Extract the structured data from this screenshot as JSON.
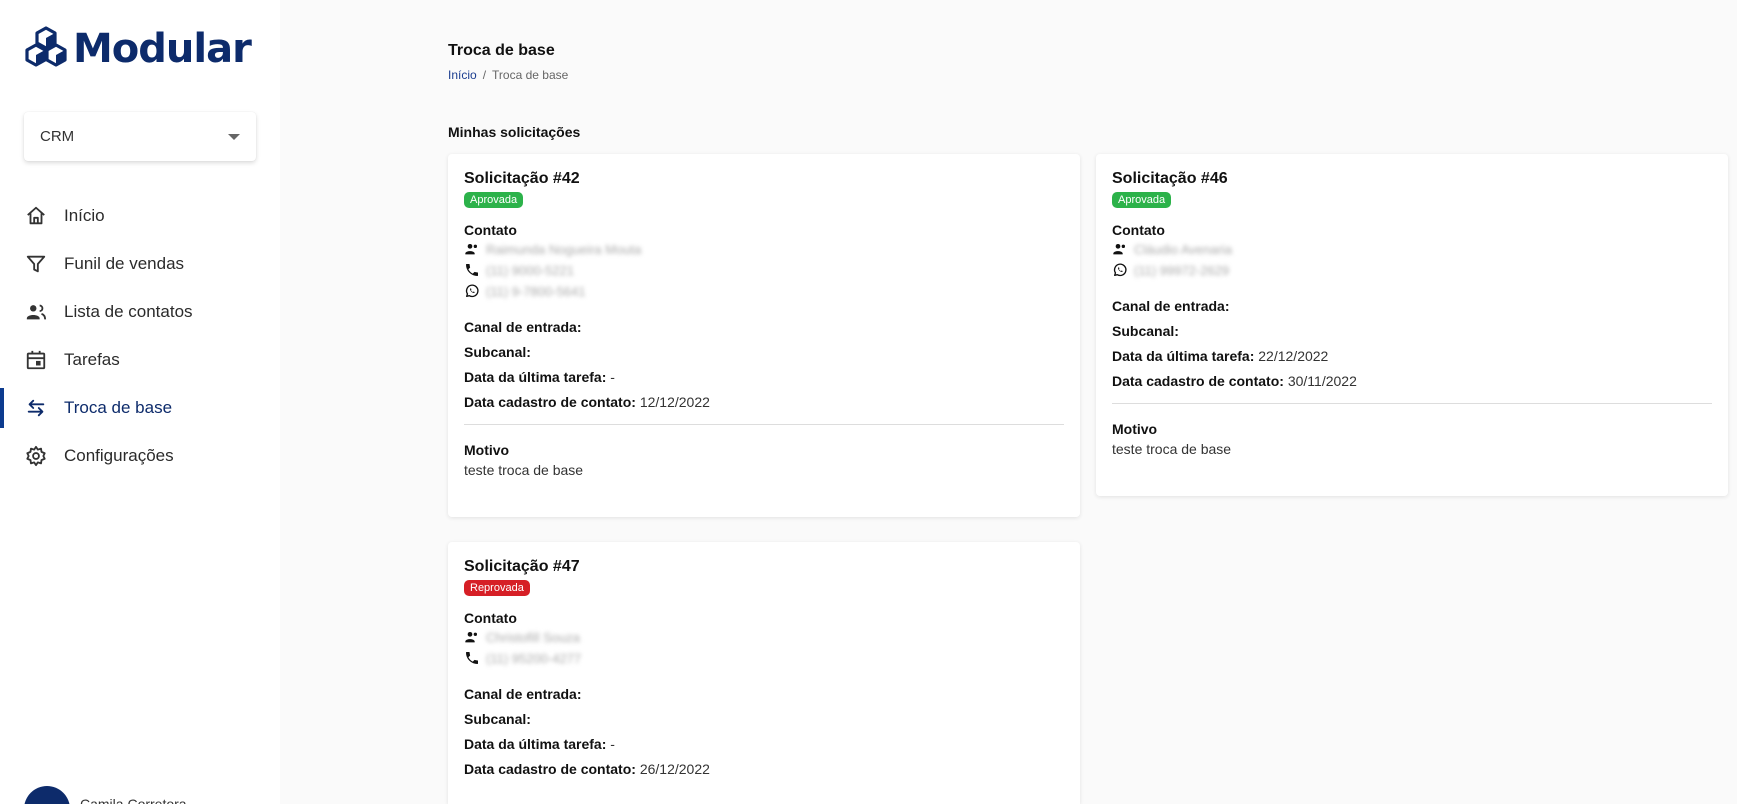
{
  "app": {
    "logo_text": "Modular"
  },
  "sidebar": {
    "module_select": {
      "value": "CRM"
    },
    "items": [
      {
        "label": "Início",
        "icon": "home-icon"
      },
      {
        "label": "Funil de vendas",
        "icon": "filter-icon"
      },
      {
        "label": "Lista de contatos",
        "icon": "contacts-icon"
      },
      {
        "label": "Tarefas",
        "icon": "calendar-icon"
      },
      {
        "label": "Troca de base",
        "icon": "swap-icon",
        "active": true
      },
      {
        "label": "Configurações",
        "icon": "gear-icon"
      }
    ],
    "user_name": "Camila Corretora"
  },
  "header": {
    "title": "Troca de base",
    "breadcrumb": {
      "home": "Início",
      "separator": "/",
      "current": "Troca de base"
    }
  },
  "section_title": "Minhas solicitações",
  "labels": {
    "contato": "Contato",
    "canal": "Canal de entrada:",
    "subcanal": "Subcanal:",
    "ultima_tarefa": "Data da última tarefa:",
    "cadastro": "Data cadastro de contato:",
    "motivo": "Motivo"
  },
  "requests": [
    {
      "title": "Solicitação #42",
      "status": "Aprovada",
      "status_color": "#2cb24a",
      "contact_name": "Raimunda Nogueira Mouta",
      "contact_phone": "(11) 9000-5221",
      "contact_whatsapp": "(11) 9-7800-5641",
      "canal": "",
      "subcanal": "",
      "ultima_tarefa": "-",
      "cadastro": "12/12/2022",
      "motivo": "teste troca de base"
    },
    {
      "title": "Solicitação #46",
      "status": "Aprovada",
      "status_color": "#2cb24a",
      "contact_name": "Cláudio Avenaria",
      "contact_whatsapp": "(11) 99972-2629",
      "canal": "",
      "subcanal": "",
      "ultima_tarefa": "22/12/2022",
      "cadastro": "30/11/2022",
      "motivo": "teste troca de base"
    },
    {
      "title": "Solicitação #47",
      "status": "Reprovada",
      "status_color": "#d61f26",
      "contact_name": "Christofill Souza",
      "contact_phone": "(11) 95200-4277",
      "canal": "",
      "subcanal": "",
      "ultima_tarefa": "-",
      "cadastro": "26/12/2022"
    }
  ]
}
